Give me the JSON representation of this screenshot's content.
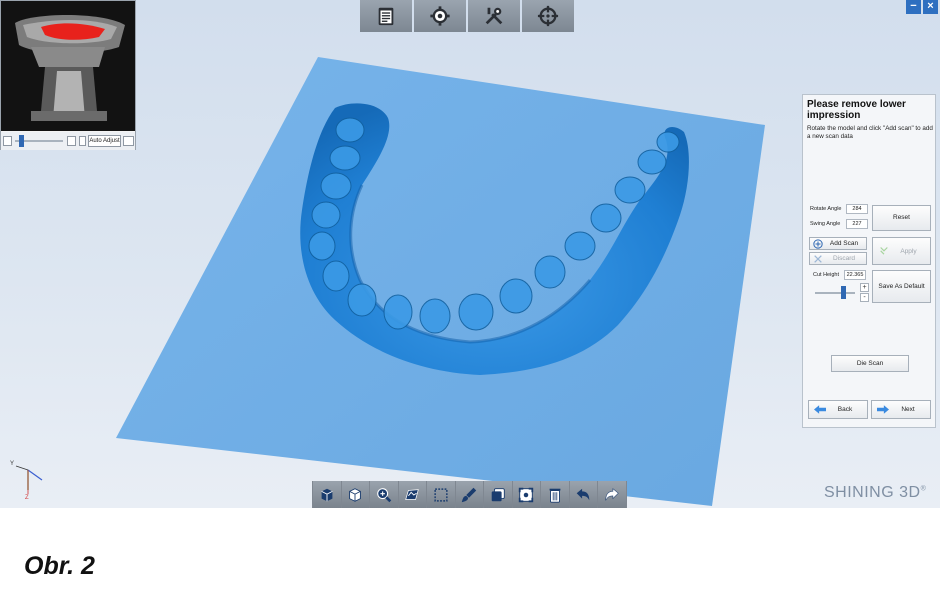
{
  "window": {
    "minimize_label": "−",
    "close_label": "×"
  },
  "top_toolbar": {
    "buttons": [
      {
        "icon": "clipboard-icon"
      },
      {
        "icon": "gear-icon"
      },
      {
        "icon": "tools-icon"
      },
      {
        "icon": "crosshair-icon"
      }
    ]
  },
  "camera_preview": {
    "auto_adjust_label": "Auto Adjust"
  },
  "panel": {
    "title": "Please remove lower impression",
    "instruction": "Rotate the model and click \"Add scan\" to add a new scan data",
    "rotate_angle_label": "Rotate Angle",
    "rotate_angle_value": "284",
    "swing_angle_label": "Swing Angle",
    "swing_angle_value": "227",
    "reset_label": "Reset",
    "add_scan_label": "Add Scan",
    "discard_label": "Discard",
    "apply_label": "Apply",
    "cut_height_label": "Cut Height",
    "cut_height_value": "22.365",
    "save_default_label": "Save As Default",
    "die_scan_label": "Die Scan",
    "back_label": "Back",
    "next_label": "Next"
  },
  "bottom_toolbar": {
    "buttons": [
      {
        "icon": "view-cube-icon"
      },
      {
        "icon": "view-cube-alt-icon"
      },
      {
        "icon": "zoom-icon"
      },
      {
        "icon": "perspective-icon"
      },
      {
        "icon": "rect-select-icon"
      },
      {
        "icon": "brush-icon"
      },
      {
        "icon": "layers-icon"
      },
      {
        "icon": "fit-view-icon"
      },
      {
        "icon": "trash-icon"
      },
      {
        "icon": "undo-icon"
      },
      {
        "icon": "redo-icon"
      }
    ]
  },
  "axis": {
    "y_label": "Y",
    "z_label": "Z"
  },
  "brand": {
    "name": "SHINING 3D",
    "mark": "®"
  },
  "caption": "Obr. 2",
  "colors": {
    "model": "#2e87d6",
    "plane": "#77b3e7",
    "accent": "#2f68b3"
  }
}
